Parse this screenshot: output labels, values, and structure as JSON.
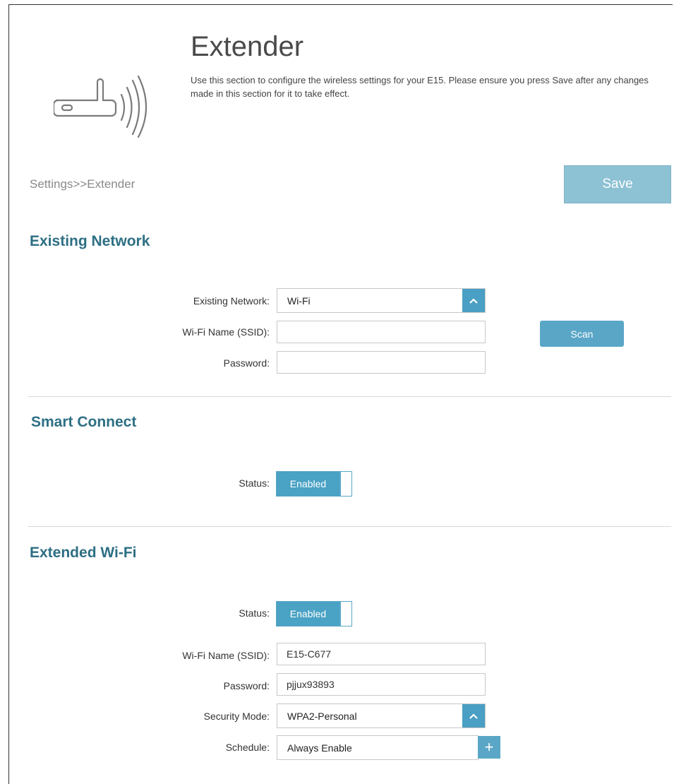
{
  "header": {
    "title": "Extender",
    "description": "Use this section to configure the wireless settings for your E15. Please ensure you press Save after any changes made in this section for it to take effect."
  },
  "breadcrumb": "Settings>>Extender",
  "toolbar": {
    "save_label": "Save"
  },
  "existing_network": {
    "section_title": "Existing Network",
    "network_label": "Existing Network:",
    "network_value": "Wi-Fi",
    "ssid_label": "Wi-Fi Name (SSID):",
    "ssid_value": "",
    "password_label": "Password:",
    "password_value": "",
    "scan_label": "Scan"
  },
  "smart_connect": {
    "section_title": "Smart Connect",
    "status_label": "Status:",
    "status_value": "Enabled"
  },
  "extended_wifi": {
    "section_title": "Extended Wi-Fi",
    "status_label": "Status:",
    "status_value": "Enabled",
    "ssid_label": "Wi-Fi Name (SSID):",
    "ssid_value": "E15-C677",
    "password_label": "Password:",
    "password_value": "pjjux93893",
    "security_label": "Security Mode:",
    "security_value": "WPA2-Personal",
    "schedule_label": "Schedule:",
    "schedule_value": "Always Enable"
  },
  "icons": {
    "logo": "extender-wifi-icon",
    "select_arrow": "chevron-up-icon",
    "schedule_add": "plus-icon"
  },
  "colors": {
    "accent": "#4aa2c4",
    "save_button": "#8dc1d4",
    "section_title": "#2d6f84"
  }
}
